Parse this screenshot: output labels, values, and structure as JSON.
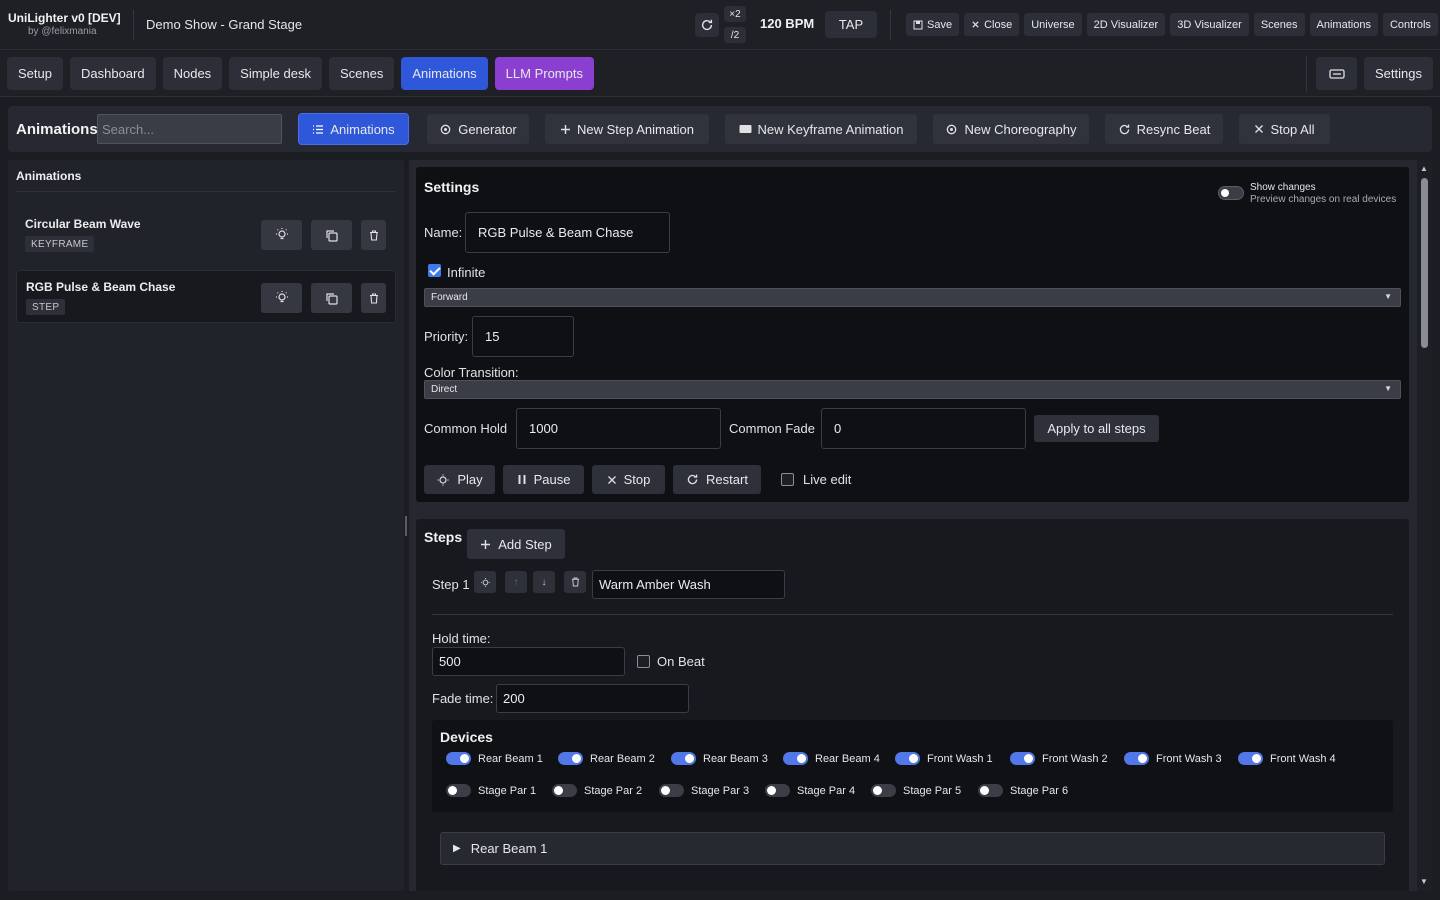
{
  "app": {
    "title": "UniLighter v0 [DEV]",
    "subtitle": "by @felixmania",
    "show_name": "Demo Show - Grand Stage"
  },
  "tempo": {
    "times_two": "×2",
    "divide_two": "/2",
    "bpm": "120 BPM",
    "tap": "TAP"
  },
  "top_actions": {
    "save": "Save",
    "close": "Close",
    "universe": "Universe",
    "visualizer_2d": "2D Visualizer",
    "visualizer_3d": "3D Visualizer",
    "scenes": "Scenes",
    "animations": "Animations",
    "controls": "Controls"
  },
  "nav": {
    "tabs": [
      "Setup",
      "Dashboard",
      "Nodes",
      "Simple desk",
      "Scenes",
      "Animations",
      "LLM Prompts"
    ],
    "settings": "Settings"
  },
  "toolbar": {
    "title": "Animations",
    "search_placeholder": "Search...",
    "animations": "Animations",
    "generator": "Generator",
    "new_step": "New Step Animation",
    "new_keyframe": "New Keyframe Animation",
    "new_choreography": "New Choreography",
    "resync": "Resync Beat",
    "stop_all": "Stop All"
  },
  "list": {
    "header": "Animations",
    "items": [
      {
        "name": "Circular Beam Wave",
        "type": "KEYFRAME"
      },
      {
        "name": "RGB Pulse & Beam Chase",
        "type": "STEP"
      }
    ]
  },
  "settings": {
    "title": "Settings",
    "show_changes": "Show changes",
    "show_changes_sub": "Preview changes on real devices",
    "name_label": "Name:",
    "name_value": "RGB Pulse & Beam Chase",
    "infinite_label": "Infinite",
    "direction": "Forward",
    "priority_label": "Priority:",
    "priority_value": "15",
    "color_transition_label": "Color Transition:",
    "color_transition": "Direct",
    "common_hold_label": "Common Hold",
    "common_hold_value": "1000",
    "common_fade_label": "Common Fade",
    "common_fade_value": "0",
    "apply_all": "Apply to all steps",
    "play": "Play",
    "pause": "Pause",
    "stop": "Stop",
    "restart": "Restart",
    "live_edit": "Live edit"
  },
  "steps": {
    "title": "Steps",
    "add_step": "Add Step",
    "step_label": "Step 1",
    "up_arrow": "↑",
    "down_arrow": "↓",
    "step_name": "Warm Amber Wash",
    "hold_label": "Hold time:",
    "hold_value": "500",
    "on_beat": "On Beat",
    "fade_label": "Fade time:",
    "fade_value": "200",
    "devices_title": "Devices",
    "devices_row1": [
      "Rear Beam 1",
      "Rear Beam 2",
      "Rear Beam 3",
      "Rear Beam 4",
      "Front Wash 1",
      "Front Wash 2",
      "Front Wash 3",
      "Front Wash 4"
    ],
    "devices_row2": [
      "Stage Par 1",
      "Stage Par 2",
      "Stage Par 3",
      "Stage Par 4",
      "Stage Par 5",
      "Stage Par 6"
    ],
    "expander": "Rear Beam 1"
  },
  "colors": {
    "accent": "#2f57d9",
    "llm": "#8b3fd1",
    "toggle_on": "#5277e8"
  }
}
